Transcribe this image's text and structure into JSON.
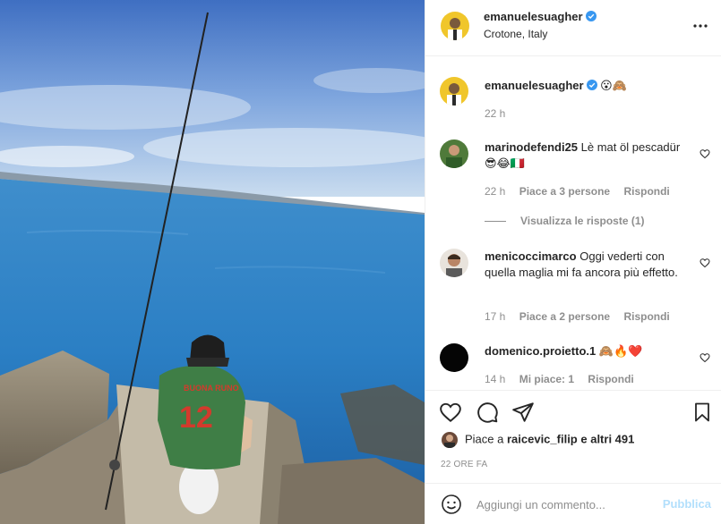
{
  "post": {
    "author": "emanuelesuagher",
    "location": "Crotone, Italy",
    "photo_alt": "fishing"
  },
  "caption": {
    "username": "emanuelesuagher",
    "emojis": "😮🙈",
    "time": "22 h"
  },
  "comments": [
    {
      "username": "marinodefendi25",
      "text": "Lè mat öl pescadür😎😂🇮🇹",
      "time": "22 h",
      "likes": "Piace a 3 persone",
      "reply": "Rispondi",
      "view_replies": "Visualizza le risposte (1)"
    },
    {
      "username": "menicoccimarco",
      "text": "Oggi vederti con quella maglia mi fa ancora più effetto.",
      "time": "17 h",
      "likes": "Piace a 2 persone",
      "reply": "Rispondi"
    },
    {
      "username": "domenico.proietto.1",
      "text": "🙈🔥❤️",
      "time": "14 h",
      "likes": "Mi piace: 1",
      "reply": "Rispondi"
    }
  ],
  "likes": {
    "prefix": "Piace a ",
    "user": "raicevic_filip",
    "suffix": " e altri 491"
  },
  "timestamp": "22 ORE FA",
  "add_comment": {
    "placeholder": "Aggiungi un commento...",
    "publish": "Pubblica"
  },
  "jersey": {
    "name": "BUONA RUNO",
    "number": "12"
  },
  "colors": {
    "verified": "#3897f0",
    "link": "#b2dffc",
    "muted": "#8e8e8e",
    "heart_red": "#ed4956"
  }
}
